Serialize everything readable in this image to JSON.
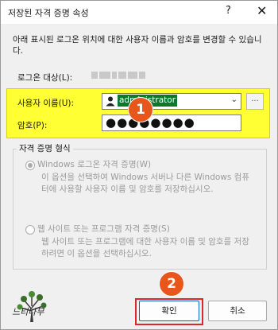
{
  "window": {
    "title": "저장된 자격 증명 속성",
    "help_glyph": "?",
    "close_glyph": "✕"
  },
  "description": "아래 표시된 로그온 위치에 대한 사용자 이름과 암호를 변경할 수 있습니다.",
  "logon_target": {
    "label": "로그온 대상(L):"
  },
  "username": {
    "label": "사용자 이름(U):",
    "value": "administrator",
    "browse_label": "..."
  },
  "password": {
    "label": "암호(P):",
    "value": "●●●●●●●●"
  },
  "credential_type": {
    "legend": "자격 증명 형식",
    "options": [
      {
        "title": "Windows 로그온 자격 증명(W)",
        "description": "이 옵션을 선택하여 Windows 서버나 다른 Windows 컴퓨터에 사용할 사용자 이름 및 암호를 저장하십시오.",
        "selected": true
      },
      {
        "title": "웹 사이트 또는 프로그램 자격 증명(S)",
        "description": "웹 사이트 또는 프로그램에 대한 사용자 이름 및 암호를 저장하려면 이 옵션을 선택하십시오.",
        "selected": false
      }
    ]
  },
  "buttons": {
    "ok": "확인",
    "cancel": "취소"
  },
  "annotations": {
    "badge1": "1",
    "badge2": "2"
  },
  "watermark": {
    "text": "느티나무"
  },
  "colors": {
    "highlight": "#ffff33",
    "badge": "#e8561c",
    "ok_frame": "#e0262a",
    "selected_text_bg": "#0a7a2a"
  }
}
